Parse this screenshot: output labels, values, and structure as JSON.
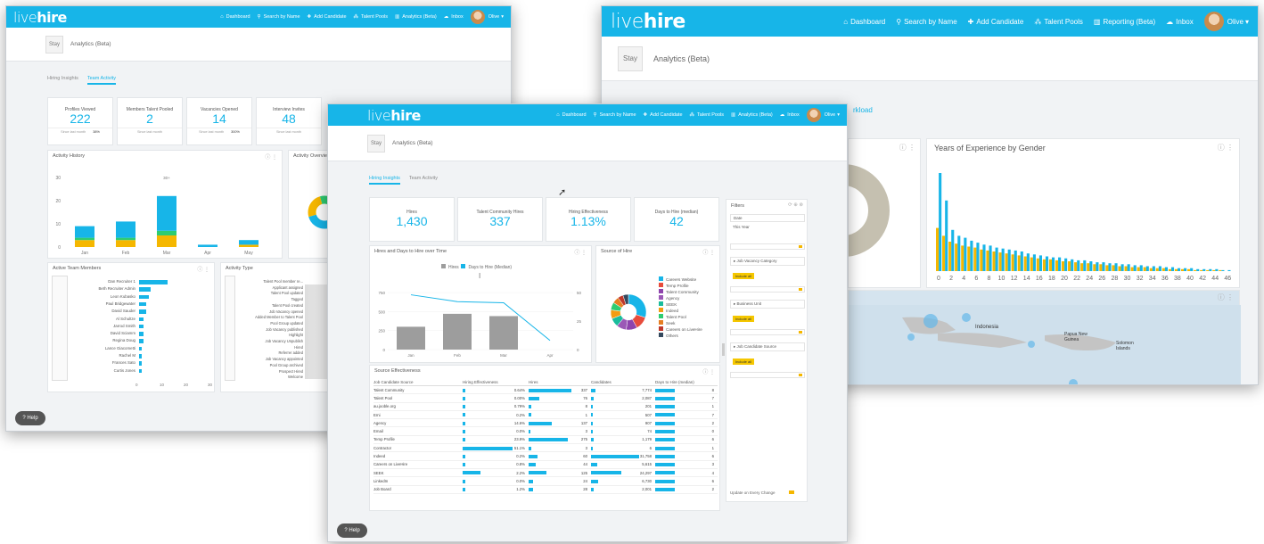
{
  "brand": {
    "logo_light": "live",
    "logo_bold": "hire",
    "company_badge": "Stay",
    "accent": "#17b5e8",
    "yellow": "#f5b700",
    "help": "Help",
    "help_icon": "question-circle-icon"
  },
  "nav_small": [
    {
      "label": "Dashboard",
      "icon": "home-icon"
    },
    {
      "label": "Search by Name",
      "icon": "search-person-icon"
    },
    {
      "label": "Add Candidate",
      "icon": "add-person-icon"
    },
    {
      "label": "Talent Pools",
      "icon": "pools-icon"
    },
    {
      "label": "Analytics (Beta)",
      "icon": "chart-icon"
    },
    {
      "label": "Inbox",
      "icon": "cloud-icon"
    },
    {
      "label": "Olive",
      "icon": "chevron-down-icon"
    }
  ],
  "nav_large": [
    {
      "label": "Dashboard",
      "icon": "home-icon"
    },
    {
      "label": "Search by Name",
      "icon": "search-person-icon"
    },
    {
      "label": "Add Candidate",
      "icon": "add-person-icon"
    },
    {
      "label": "Talent Pools",
      "icon": "pools-icon"
    },
    {
      "label": "Reporting (Beta)",
      "icon": "chart-icon"
    },
    {
      "label": "Inbox",
      "icon": "cloud-icon"
    },
    {
      "label": "Olive",
      "icon": "chevron-down-icon"
    }
  ],
  "page_title": "Analytics (Beta)",
  "tabs": [
    "Hiring Insights",
    "Team Activity"
  ],
  "left": {
    "kpis": [
      {
        "label": "Profiles Viewed",
        "value": "222",
        "note": "Since last month",
        "delta": "38%"
      },
      {
        "label": "Members Talent Pooled",
        "value": "2",
        "note": "Since last month",
        "delta": ""
      },
      {
        "label": "Vacancies Opened",
        "value": "14",
        "note": "Since last month",
        "delta": "300%"
      },
      {
        "label": "Interview Invites",
        "value": "48",
        "note": "Since last month",
        "delta": ""
      }
    ],
    "activity_title": "Activity History",
    "activity_overview": "Activity Overview",
    "activity_ymax": "30",
    "activity_yticks": [
      "30",
      "20",
      "10",
      "0"
    ],
    "activity_months": [
      "Jan",
      "Feb",
      "Mar",
      "Apr",
      "May"
    ],
    "activity_peak": "30+",
    "activity_stacks": [
      {
        "blue": 5,
        "yellow": 3,
        "green": 1
      },
      {
        "blue": 7,
        "yellow": 3,
        "green": 1
      },
      {
        "blue": 15,
        "yellow": 5,
        "green": 2
      },
      {
        "blue": 1,
        "yellow": 0,
        "green": 0
      },
      {
        "blue": 2,
        "yellow": 1,
        "green": 0
      }
    ],
    "team_title": "Active Team Members",
    "team_members": [
      "Dan Recruiter 1",
      "Beth Recruiter Admin",
      "Leon Kubasko",
      "Paul Bridgewater",
      "David Sauder",
      "Al Schultze",
      "Jarrod Smith",
      "David Sciamm",
      "Regina Doug",
      "Lance Giacometti",
      "Rachel M",
      "Frances Sato",
      "Curtis Jones"
    ],
    "team_values": [
      12,
      5,
      4,
      3,
      3,
      2,
      2,
      2,
      2,
      1,
      1,
      1,
      1
    ],
    "team_axis": [
      "0",
      "10",
      "20",
      "30"
    ],
    "activity_type_title": "Activity Type",
    "activity_types": [
      "Talent Pool member re...",
      "Applicant assigned",
      "Talent Pool updated",
      "Tagged",
      "Talent Pool created",
      "Job Vacancy opened",
      "Added Member to Talent Pool",
      "Pool Group updated",
      "Job Vacancy published",
      "Highlight",
      "Job Vacancy Unpublish",
      "Hired",
      "Referrer added",
      "Job Vacancy appointed",
      "Pool Group archived",
      "Prospect Hired",
      "Welcome"
    ]
  },
  "center": {
    "kpis": [
      {
        "label": "Hires",
        "value": "1,430"
      },
      {
        "label": "Talent Community Hires",
        "value": "337"
      },
      {
        "label": "Hiring Effectiveness",
        "value": "1.13%"
      },
      {
        "label": "Days to Hire (median)",
        "value": "42"
      }
    ],
    "hires_chart_title": "Hires and Days to Hire over Time",
    "hires_legend": [
      "Hires",
      "Days to Hire (Median)"
    ],
    "hires_months": [
      "Jan",
      "Feb",
      "Mar",
      "Apr"
    ],
    "hires_left_ticks": [
      "750",
      "500",
      "250",
      "0"
    ],
    "hires_right_ticks": [
      "50",
      "25",
      "0"
    ],
    "hires_values": [
      300,
      470,
      440,
      0
    ],
    "days_values": [
      48,
      42,
      41,
      8
    ],
    "source_title": "Source of Hire",
    "source_legend": [
      "Careers Website",
      "Temp Profile",
      "Talent Community",
      "Agency",
      "SEEK",
      "Indeed",
      "Talent Pool",
      "Seek",
      "Careers on LiveHire",
      "Others"
    ],
    "source_colors": [
      "#17b5e8",
      "#e74c3c",
      "#8e44ad",
      "#9b59b6",
      "#1abc9c",
      "#f39c12",
      "#2ecc71",
      "#e67e22",
      "#c0392b",
      "#34495e"
    ],
    "source_values": [
      30,
      12,
      10,
      9,
      8,
      8,
      7,
      6,
      5,
      5
    ],
    "effect_title": "Source Effectiveness",
    "effect_headers": [
      "Job Candidate Source",
      "Hiring Effectiveness",
      "Hires",
      "Candidates",
      "Days to Hire (median)"
    ],
    "effect_rows": [
      {
        "name": "Talent Community",
        "eff": "0.64%",
        "effw": 3,
        "hires": "337",
        "hw": 48,
        "cand": "7,774",
        "cw": 5,
        "days": "8",
        "dw": 22
      },
      {
        "name": "Talent Pool",
        "eff": "0.00%",
        "effw": 3,
        "hires": "76",
        "hw": 12,
        "cand": "2,087",
        "cw": 3,
        "days": "7",
        "dw": 22
      },
      {
        "name": "au.jooble.org",
        "eff": "0.79%",
        "effw": 3,
        "hires": "8",
        "hw": 3,
        "cand": "201",
        "cw": 2,
        "days": "1",
        "dw": 22
      },
      {
        "name": "Erni",
        "eff": "0.2%",
        "effw": 3,
        "hires": "1",
        "hw": 3,
        "cand": "507",
        "cw": 2,
        "days": "7",
        "dw": 22
      },
      {
        "name": "Agency",
        "eff": "14.6%",
        "effw": 3,
        "hires": "137",
        "hw": 26,
        "cand": "907",
        "cw": 2,
        "days": "2",
        "dw": 22
      },
      {
        "name": "Email",
        "eff": "0.0%",
        "effw": 3,
        "hires": "3",
        "hw": 2,
        "cand": "74",
        "cw": 2,
        "days": "0",
        "dw": 22
      },
      {
        "name": "Temp Profile",
        "eff": "23.9%",
        "effw": 3,
        "hires": "275",
        "hw": 44,
        "cand": "1,179",
        "cw": 3,
        "days": "6",
        "dw": 22
      },
      {
        "name": "Contractor",
        "eff": "51.1%",
        "effw": 56,
        "hires": "3",
        "hw": 3,
        "cand": "6",
        "cw": 2,
        "days": "1",
        "dw": 22
      },
      {
        "name": "Indeed",
        "eff": "0.2%",
        "effw": 3,
        "hires": "60",
        "hw": 10,
        "cand": "31,758",
        "cw": 54,
        "days": "6",
        "dw": 22
      },
      {
        "name": "Careers on LiveHire",
        "eff": "0.8%",
        "effw": 3,
        "hires": "44",
        "hw": 8,
        "cand": "5,615",
        "cw": 7,
        "days": "3",
        "dw": 22
      },
      {
        "name": "SEEK",
        "eff": "2.2%",
        "effw": 20,
        "hires": "125",
        "hw": 20,
        "cand": "24,297",
        "cw": 34,
        "days": "4",
        "dw": 22
      },
      {
        "name": "LinkedIn",
        "eff": "0.0%",
        "effw": 3,
        "hires": "24",
        "hw": 5,
        "cand": "6,730",
        "cw": 8,
        "days": "6",
        "dw": 22
      },
      {
        "name": "Job Board",
        "eff": "1.2%",
        "effw": 3,
        "hires": "28",
        "hw": 5,
        "cand": "2,001",
        "cw": 3,
        "days": "2",
        "dw": 22
      }
    ],
    "filters_title": "Filters",
    "filters": [
      {
        "label": "Date",
        "value": "This Year",
        "select_all": ""
      },
      {
        "label": "Job Vacancy Category",
        "value": "",
        "select_all": "Include all"
      },
      {
        "label": "Business Unit",
        "value": "",
        "select_all": "Include all"
      },
      {
        "label": "Job Candidate Source",
        "value": "",
        "select_all": "Include all"
      }
    ],
    "filters_footer": "Update on Every Change"
  },
  "right": {
    "workload": "rkload",
    "exp_title": "Years of Experience by Gender",
    "exp_ticks": [
      "0",
      "2",
      "4",
      "6",
      "8",
      "10",
      "12",
      "14",
      "16",
      "18",
      "20",
      "22",
      "24",
      "26",
      "28",
      "30",
      "32",
      "34",
      "36",
      "38",
      "40",
      "42",
      "44",
      "46"
    ],
    "exp_blue": [
      100,
      72,
      42,
      36,
      34,
      31,
      29,
      27,
      26,
      24,
      23,
      22,
      21,
      20,
      18,
      17,
      16,
      15,
      14,
      14,
      13,
      12,
      11,
      11,
      10,
      9,
      9,
      8,
      8,
      7,
      7,
      6,
      6,
      5,
      5,
      5,
      4,
      4,
      3,
      3,
      3,
      2,
      2,
      2,
      2,
      1,
      1
    ],
    "exp_yellow": [
      44,
      36,
      30,
      28,
      26,
      25,
      24,
      22,
      21,
      20,
      19,
      18,
      17,
      16,
      15,
      14,
      13,
      12,
      12,
      11,
      10,
      10,
      9,
      8,
      8,
      7,
      7,
      6,
      6,
      5,
      5,
      4,
      4,
      4,
      3,
      3,
      3,
      2,
      2,
      2,
      2,
      1,
      1,
      1,
      1,
      1,
      0
    ],
    "map_labels": [
      "Indonesia",
      "Papua New Guinea",
      "Solomon Islands"
    ]
  }
}
